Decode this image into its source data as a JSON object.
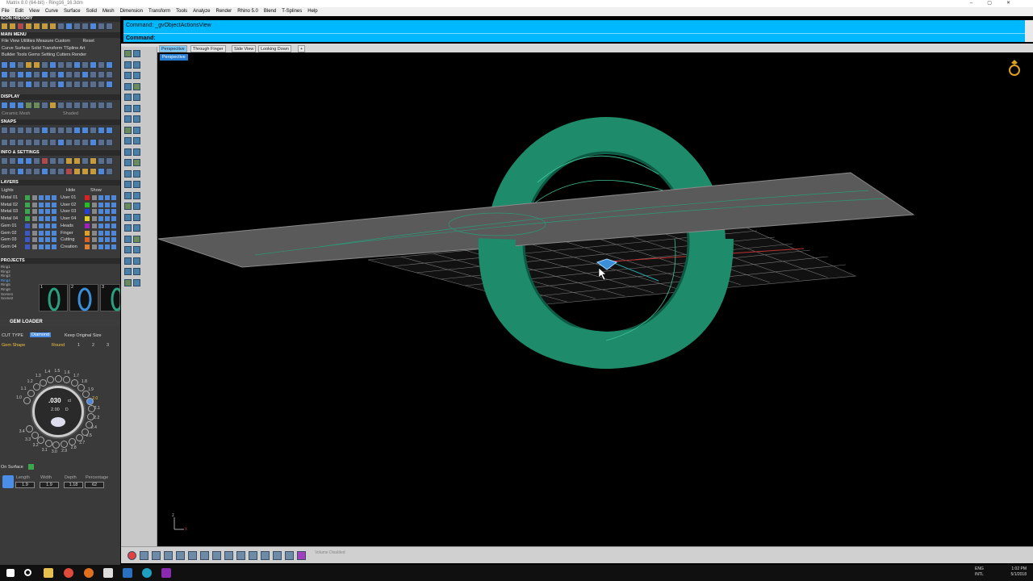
{
  "window": {
    "title": "Matrix 8.0 (64-bit) - Ring16_16.3dm"
  },
  "menubar": [
    "File",
    "Edit",
    "View",
    "Curve",
    "Surface",
    "Solid",
    "Mesh",
    "Dimension",
    "Transform",
    "Tools",
    "Analyze",
    "Render",
    "Rhino 5.0",
    "Blend",
    "T-Splines",
    "Help"
  ],
  "left_panel": {
    "icon_history": "ICON HISTORY",
    "main_menu": "MAIN MENU",
    "main_menu_items": [
      "File",
      "View",
      "Utilities",
      "Measure",
      "Custom",
      "Reset"
    ],
    "main_menu_sub": "Curve  Surface  Solid  Transform  TSpline  Art",
    "main_menu_sub2": "Builder  Tools  Gems  Setting  Cutters  Render",
    "display": "DISPLAY",
    "display_modes": [
      "Ceramic Mesh",
      "Shaded"
    ],
    "snaps": "SNAPS",
    "info_settings": "INFO & SETTINGS",
    "layers": "LAYERS",
    "layers_header": {
      "lights": "Lights",
      "hide": "Hide",
      "show": "Show"
    },
    "layers_left": [
      {
        "name": "Metal 01",
        "color": "#3aa84a"
      },
      {
        "name": "Metal 02",
        "color": "#3aa84a"
      },
      {
        "name": "Metal 03",
        "color": "#3aa84a"
      },
      {
        "name": "Metal 04",
        "color": "#3aa84a"
      },
      {
        "name": "Gem 01",
        "color": "#3a58c8"
      },
      {
        "name": "Gem 02",
        "color": "#3a58c8"
      },
      {
        "name": "Gem 03",
        "color": "#3a58c8"
      },
      {
        "name": "Gem 04",
        "color": "#3a58c8"
      }
    ],
    "layers_right": [
      {
        "name": "User 01",
        "color": "#e02020"
      },
      {
        "name": "User 02",
        "color": "#20c020"
      },
      {
        "name": "User 03",
        "color": "#2040e0"
      },
      {
        "name": "User 04",
        "color": "#e0d020"
      },
      {
        "name": "Heads",
        "color": "#a020c0"
      },
      {
        "name": "Finger",
        "color": "#e0a020"
      },
      {
        "name": "Cutting",
        "color": "#e06020"
      },
      {
        "name": "Creation",
        "color": "#e08030"
      }
    ],
    "projects": "PROJECTS",
    "projects_list": [
      "Ring1",
      "Ring2",
      "Ring3",
      "Ring4",
      "Ring5",
      "Ring6",
      "Scene1",
      "Scene2"
    ],
    "project_nums": [
      "1",
      "2",
      "3"
    ],
    "gem_loader": "GEM LOADER",
    "cut_type_label": "CUT TYPE",
    "cut_type_value": "Diamond",
    "keep_original": "Keep Original Size",
    "gem_shape_label": "Gem Shape",
    "gem_shape_value": "Round",
    "gem_shape_pages": [
      "1",
      "2",
      "3"
    ],
    "dial_value": ".030",
    "dial_unit": "ct",
    "dial_size": "2.00",
    "dial_size_unit": "D",
    "dial_numbers": [
      "1.0",
      "1.1",
      "1.2",
      "1.3",
      "1.4",
      "1.5",
      "1.6",
      "1.7",
      "1.8",
      "1.9",
      "2.0",
      "2.1",
      "2.2",
      "2.4",
      "2.5",
      "2.7",
      "2.8",
      "2.9",
      "3.0",
      "3.1",
      "3.2",
      "3.3",
      "3.4"
    ],
    "on_surface": "On Surface",
    "dims_labels": [
      "Length",
      "Width",
      "Depth",
      "Percentage"
    ],
    "dims_values": [
      "1.9",
      "1.9",
      "1.18",
      "62"
    ]
  },
  "command": {
    "line1": "Command: _gvObjectActionsView",
    "line2": "Command:"
  },
  "viewport_tabs": [
    "Perspective",
    "Through Finger",
    "Side View",
    "Looking Down",
    "+"
  ],
  "viewport_label": "Perspective",
  "status": {
    "volume": "Volume Disabled"
  },
  "taskbar": {
    "lang": "ENG",
    "layout": "INTL",
    "time": "1:02 PM",
    "date": "5/1/2018"
  },
  "colors": {
    "command_bg": "#00b8ff",
    "ring": "#1e8c6a",
    "plane": "#5a5a5a"
  }
}
